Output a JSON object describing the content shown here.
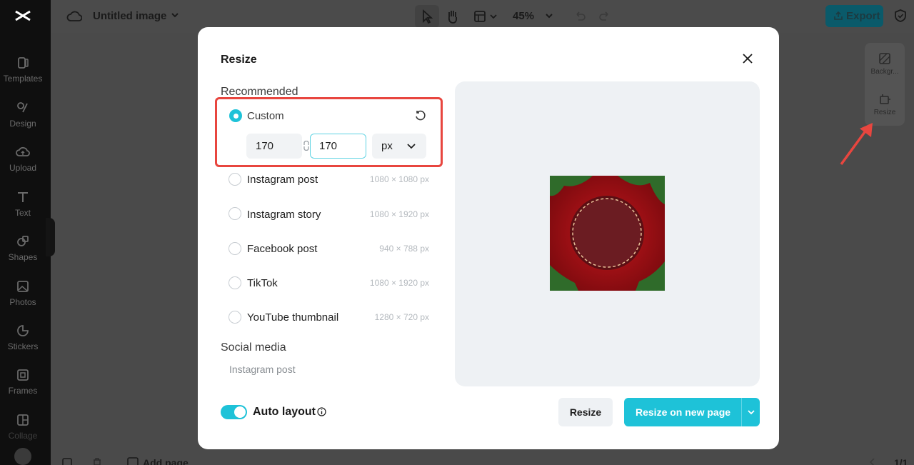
{
  "app": {
    "doc_title": "Untitled image",
    "zoom": "45%",
    "export_label": "Export",
    "accent_color": "#1ec2d8",
    "highlight_color": "#e8463f"
  },
  "sidebar": {
    "items": [
      {
        "label": "Templates",
        "icon": "templates-icon"
      },
      {
        "label": "Design",
        "icon": "design-icon"
      },
      {
        "label": "Upload",
        "icon": "upload-icon"
      },
      {
        "label": "Text",
        "icon": "text-icon"
      },
      {
        "label": "Shapes",
        "icon": "shapes-icon"
      },
      {
        "label": "Photos",
        "icon": "photos-icon"
      },
      {
        "label": "Stickers",
        "icon": "stickers-icon"
      },
      {
        "label": "Frames",
        "icon": "frames-icon"
      },
      {
        "label": "Collage",
        "icon": "collage-icon"
      }
    ]
  },
  "right_panel": {
    "background_label": "Backgr...",
    "resize_label": "Resize"
  },
  "bottom": {
    "add_page": "Add page",
    "page_count": "1/1"
  },
  "modal": {
    "title": "Resize",
    "recommended_heading": "Recommended",
    "custom": {
      "label": "Custom",
      "width": "170",
      "height": "170",
      "unit": "px",
      "selected": true
    },
    "presets": [
      {
        "label": "Instagram post",
        "size": "1080 × 1080 px"
      },
      {
        "label": "Instagram story",
        "size": "1080 × 1920 px"
      },
      {
        "label": "Facebook post",
        "size": "940 × 788 px"
      },
      {
        "label": "TikTok",
        "size": "1080 × 1920 px"
      },
      {
        "label": "YouTube thumbnail",
        "size": "1280 × 720 px"
      }
    ],
    "social_heading": "Social media",
    "social_items": [
      "Instagram post"
    ],
    "auto_layout": {
      "label": "Auto layout",
      "enabled": true
    },
    "resize_button": "Resize",
    "resize_new_page_button": "Resize on new page"
  }
}
